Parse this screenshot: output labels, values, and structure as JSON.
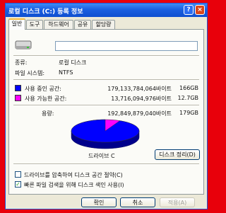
{
  "window": {
    "title": "로컬 디스크 (C:) 등록 정보",
    "help_label": "?",
    "close_label": "×"
  },
  "tabs": [
    "일반",
    "도구",
    "하드웨어",
    "공유",
    "할당량"
  ],
  "general": {
    "name_value": "",
    "type_label": "종류:",
    "type_value": "로컬 디스크",
    "fs_label": "파일 시스템:",
    "fs_value": "NTFS",
    "used_label": "사용 중인 공간:",
    "used_bytes": "179,133,784,064바이트",
    "used_size": "166GB",
    "free_label": "사용 가능한 공간:",
    "free_bytes": "13,716,094,976바이트",
    "free_size": "12.7GB",
    "capacity_label": "용량:",
    "capacity_bytes": "192,849,879,040바이트",
    "capacity_size": "179GB",
    "drive_label": "드라이브 C",
    "cleanup_label": "디스크 정리(D)",
    "compress_label": "드라이브를 압축하여 디스크 공간 절약(C)",
    "index_label": "빠른 파일 검색을 위해 디스크 색인 사용(I)",
    "compress_checked": false,
    "index_checked": true,
    "used_fraction": 0.929
  },
  "buttons": {
    "ok": "확인",
    "cancel": "취소",
    "apply": "적용(A)"
  },
  "colors": {
    "used": "#0000ff",
    "free": "#ff00ff",
    "accent": "#e8000b"
  },
  "icons": {
    "drive": "hard-drive-icon",
    "check": "checkmark-icon"
  }
}
